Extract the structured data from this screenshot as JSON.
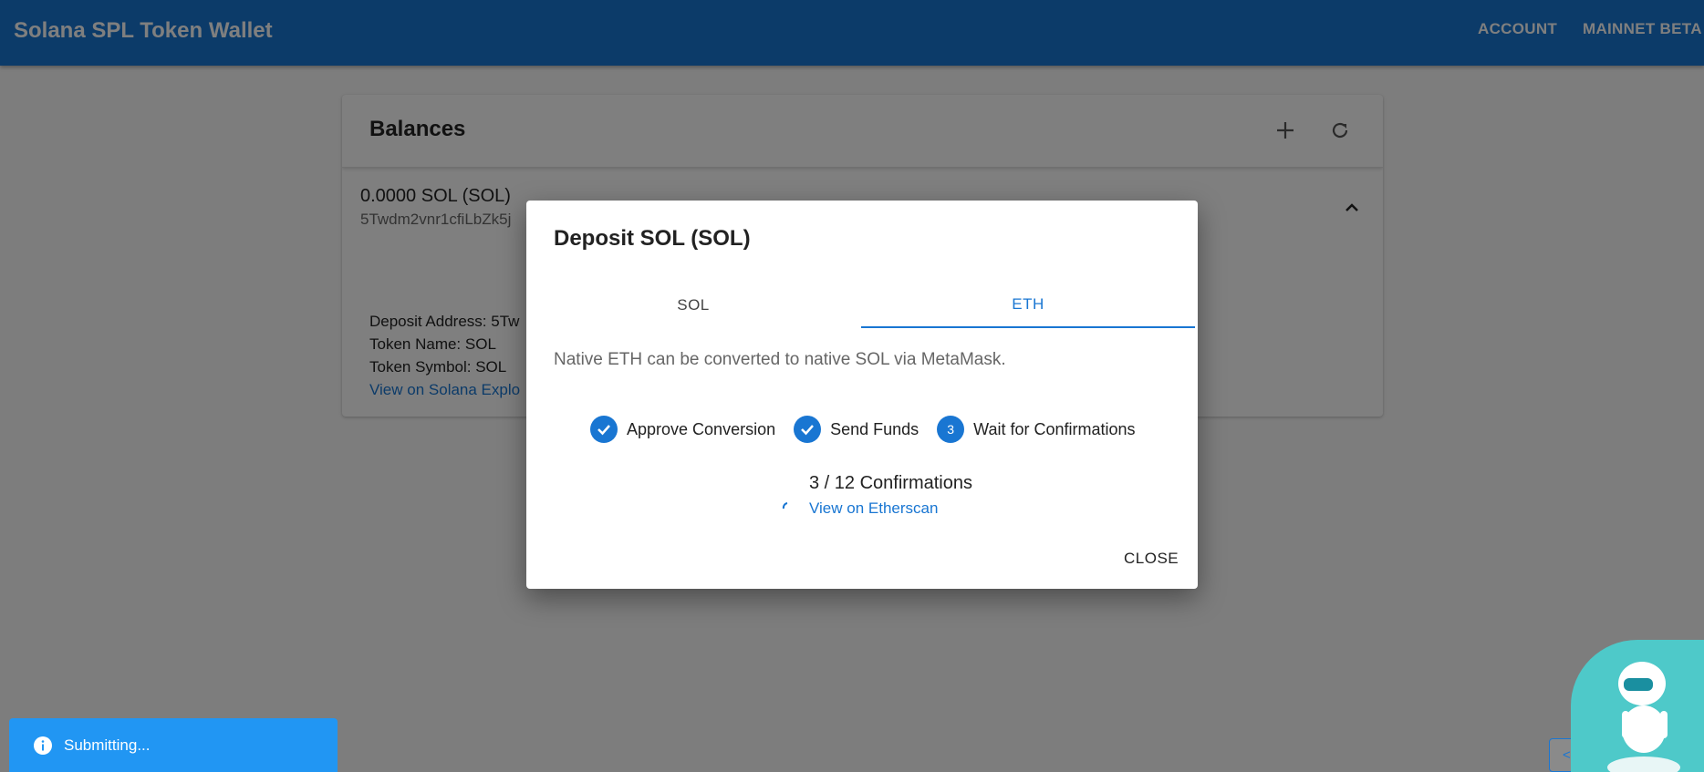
{
  "appbar": {
    "title": "Solana SPL Token Wallet",
    "account_label": "ACCOUNT",
    "network_label": "MAINNET BETA"
  },
  "balances": {
    "title": "Balances",
    "add_icon": "plus-icon",
    "refresh_icon": "refresh-icon",
    "token": {
      "balance": "0.0000 SOL (SOL)",
      "address": "5Twdm2vnr1cfiLbZk5j",
      "deposit_address": "Deposit Address: 5Tw",
      "token_name": "Token Name: SOL",
      "token_symbol": "Token Symbol: SOL",
      "explorer_link": "View on Solana Explo"
    }
  },
  "dialog": {
    "title": "Deposit SOL (SOL)",
    "tabs": [
      {
        "label": "SOL",
        "active": false
      },
      {
        "label": "ETH",
        "active": true
      }
    ],
    "description": "Native ETH can be converted to native SOL via MetaMask.",
    "steps": [
      {
        "label": "Approve Conversion",
        "state": "done"
      },
      {
        "label": "Send Funds",
        "state": "done"
      },
      {
        "label": "Wait for Confirmations",
        "state": "active",
        "number": "3"
      }
    ],
    "confirmations": "3 / 12 Confirmations",
    "etherscan_link": "View on Etherscan",
    "close_label": "CLOSE"
  },
  "snackbar": {
    "text": "Submitting...",
    "icon": "info-icon"
  },
  "colors": {
    "primary": "#1976d2",
    "snackbar": "#2196f3",
    "bot": "#4ec9c9"
  }
}
